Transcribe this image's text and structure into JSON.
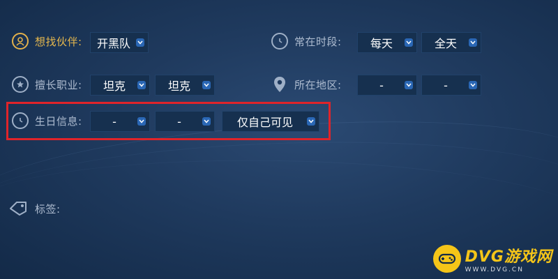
{
  "fields": {
    "partner": {
      "label": "想找伙伴:",
      "value": "开黑队"
    },
    "time": {
      "label": "常在时段:",
      "day": "每天",
      "span": "全天"
    },
    "role": {
      "label": "擅长职业:",
      "first": "坦克",
      "second": "坦克"
    },
    "region": {
      "label": "所在地区:",
      "province": "-",
      "city": "-"
    },
    "birthday": {
      "label": "生日信息:",
      "month": "-",
      "day": "-",
      "visibility": "仅自己可见"
    },
    "tags": {
      "label": "标签:"
    }
  },
  "watermark": {
    "title": "DVG游戏网",
    "subtitle": "WWW.DVG.CN"
  },
  "colors": {
    "accent_gold": "#e6b84e",
    "highlight_red": "#e0242a",
    "dropdown_chevron": "#2a67b5"
  },
  "icons": {
    "partner": "user-circle-icon",
    "time": "clock-icon",
    "role": "star-icon",
    "region": "location-pin-icon",
    "birthday": "clock-icon",
    "tags": "tag-icon"
  }
}
